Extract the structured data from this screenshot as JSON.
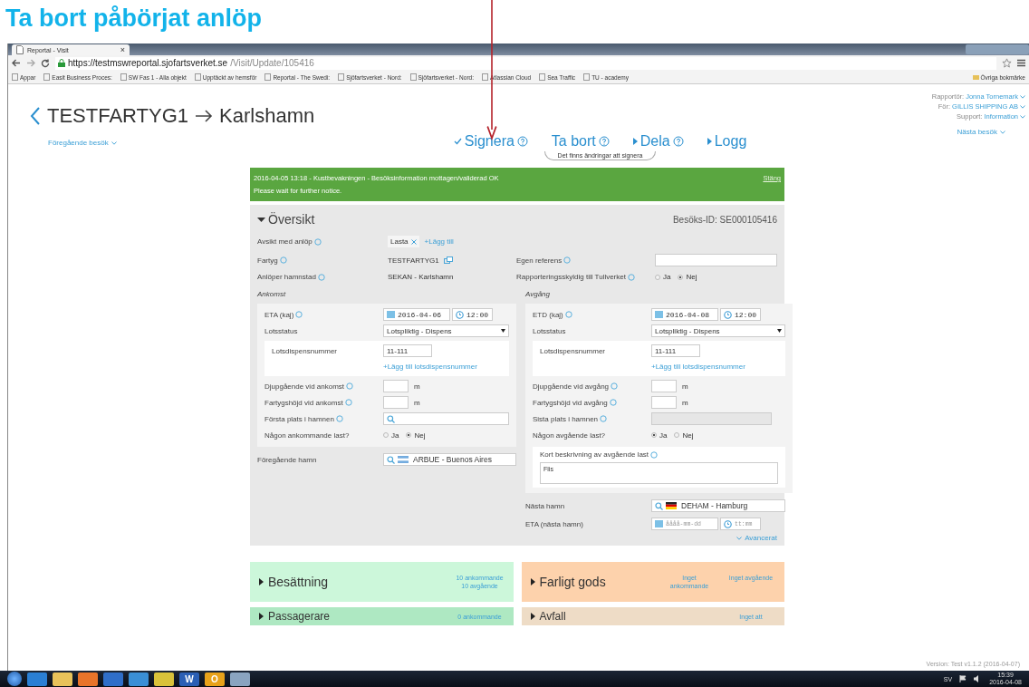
{
  "slide_title": "Ta bort påbörjat anlöp",
  "browser": {
    "tab_title": "Reportal - Visit",
    "tab_close": "×",
    "url_host": "https://testmswreportal.sjofartsverket.se",
    "url_path": "/Visit/Update/105416",
    "bookmarks": [
      "Appar",
      "Easit Business Proces:",
      "SW Fas 1 - Alla objekt",
      "Upptäckt av hemsför",
      "Reportal - The Swedi:",
      "Sjöfartsverket - Nord:",
      "Sjöfartsverket - Nord:",
      "Atlassian Cloud",
      "Sea Traffic",
      "TU - academy"
    ],
    "other_bookmarks": "Övriga bokmärke"
  },
  "header": {
    "vessel": "TESTFARTYG1",
    "port": "Karlshamn",
    "previous_visit": "Föregående besök",
    "next_visit": "Nästa besök",
    "user": [
      {
        "label": "Rapportör:",
        "value": "Jonna Tornemark"
      },
      {
        "label": "För:",
        "value": "GILLIS SHIPPING AB"
      },
      {
        "label": "Support:",
        "value": "Information"
      }
    ]
  },
  "actions": [
    {
      "label": "Signera",
      "kind": "check",
      "help": true
    },
    {
      "label": "Ta bort",
      "kind": "plain",
      "help": true
    },
    {
      "label": "Dela",
      "kind": "caret",
      "help": true
    },
    {
      "label": "Logg",
      "kind": "caret",
      "help": false
    }
  ],
  "notice": "Det finns ändringar att signera",
  "alert": {
    "time": "2016-04-05 13:18",
    "message": " - Kustbevakningen - Besöksinformation mottagen/validerad OK",
    "detail": "Please wait for further notice.",
    "close": "Stäng"
  },
  "overview": {
    "title": "Översikt",
    "expanded": true,
    "visit_id": "Besöks-ID: SE000105416",
    "purpose": {
      "label": "Avsikt med anlöp",
      "tags": [
        "Lasta"
      ],
      "add": "+Lägg till"
    },
    "top_rows": [
      [
        {
          "label": "Fartyg",
          "help": true,
          "kind": "text",
          "value": "TESTFARTYG1",
          "link_icon": true
        },
        {
          "label": "Egen referens",
          "help": true,
          "kind": "input"
        }
      ],
      [
        {
          "label": "Anlöper hamnstad",
          "help": true,
          "kind": "text",
          "value": "SEKAN - Karlshamn",
          "link_icon": false
        },
        {
          "label": "Rapporteringsskyldig till Tullverket",
          "help": true,
          "kind": "radio",
          "options": [
            {
              "label": "Ja",
              "selected": false
            },
            {
              "label": "Nej",
              "selected": true
            }
          ]
        }
      ]
    ],
    "arrival": {
      "heading": "Ankomst",
      "fields": [
        {
          "kind": "date_time",
          "label": "ETA (kaj)",
          "help": true,
          "date": "2016-04-06",
          "time": "12:00"
        },
        {
          "kind": "select",
          "label": "Lotsstatus",
          "help": false,
          "value": "Lotspliktig - Dispens"
        },
        {
          "kind": "dispensation",
          "label": "Lotsdispensnummer",
          "value": "11-111",
          "add": "+Lägg till lotsdispensnummer"
        },
        {
          "kind": "short_input",
          "label": "Djupgående vid ankomst",
          "help": true,
          "unit": "m"
        },
        {
          "kind": "short_input",
          "label": "Fartygshöjd vid ankomst",
          "help": true,
          "unit": "m"
        },
        {
          "kind": "search",
          "label": "Första plats i hamnen",
          "help": true
        },
        {
          "kind": "radio",
          "label": "Någon ankommande last?",
          "help": false,
          "options": [
            {
              "label": "Ja",
              "selected": false
            },
            {
              "label": "Nej",
              "selected": true
            }
          ]
        }
      ],
      "after": [
        {
          "kind": "search",
          "label": "Föregående hamn",
          "help": false,
          "value": "ARBUE - Buenos Aires",
          "flag": true
        }
      ]
    },
    "departure": {
      "heading": "Avgång",
      "fields": [
        {
          "kind": "date_time",
          "label": "ETD (kaj)",
          "help": true,
          "date": "2016-04-08",
          "time": "12:00"
        },
        {
          "kind": "select",
          "label": "Lotsstatus",
          "help": false,
          "value": "Lotspliktig - Dispens"
        },
        {
          "kind": "dispensation",
          "label": "Lotsdispensnummer",
          "value": "11-111",
          "add": "+Lägg till lotsdispensnummer"
        },
        {
          "kind": "short_input",
          "label": "Djupgående vid avgång",
          "help": true,
          "unit": "m"
        },
        {
          "kind": "short_input",
          "label": "Fartygshöjd vid avgång",
          "help": true,
          "unit": "m"
        },
        {
          "kind": "disabled",
          "label": "Sista plats i hamnen",
          "help": true
        },
        {
          "kind": "radio",
          "label": "Någon avgående last?",
          "help": false,
          "options": [
            {
              "label": "Ja",
              "selected": true
            },
            {
              "label": "Nej",
              "selected": false
            }
          ]
        },
        {
          "kind": "description",
          "label": "Kort beskrivning av avgående last",
          "help": true,
          "value": "Flis"
        }
      ],
      "after": [
        {
          "kind": "search",
          "label": "Nästa hamn",
          "help": false,
          "value": "DEHAM - Hamburg",
          "flag": true
        },
        {
          "kind": "date_time",
          "label": "ETA (nästa hamn)",
          "help": false,
          "date_placeholder": "åååå-mm-dd",
          "time_placeholder": "tt:mm"
        }
      ]
    },
    "advanced": "Avancerat"
  },
  "sections": [
    {
      "title": "Besättning",
      "color": "#ccf7da",
      "notes": [
        {
          "text": "10 ankommande 10 avgående"
        }
      ]
    },
    {
      "title": "Farligt gods",
      "color": "#fdd2ac",
      "notes": [
        {
          "text": "Inget ankommande"
        },
        {
          "text": "Inget avgående"
        }
      ]
    },
    {
      "title": "Passagerare",
      "color": "#aee8c2",
      "notes": [
        {
          "text": "0 ankommande"
        }
      ]
    },
    {
      "title": "Avfall",
      "color": "#eedcc6",
      "notes": [
        {
          "text": "Inget att"
        }
      ]
    }
  ],
  "version": "Version: Test v1.1.2 (2016-04-07)",
  "taskbar": {
    "apps": [
      {
        "kind": "ie"
      },
      {
        "kind": "folder"
      },
      {
        "kind": "media"
      },
      {
        "kind": "player"
      },
      {
        "kind": "app"
      },
      {
        "kind": "chrome"
      },
      {
        "kind": "word",
        "letter": "W"
      },
      {
        "kind": "outlook",
        "letter": "O"
      },
      {
        "kind": "paint"
      }
    ],
    "language": "SV",
    "time": "15:39",
    "date": "2016-04-08"
  }
}
